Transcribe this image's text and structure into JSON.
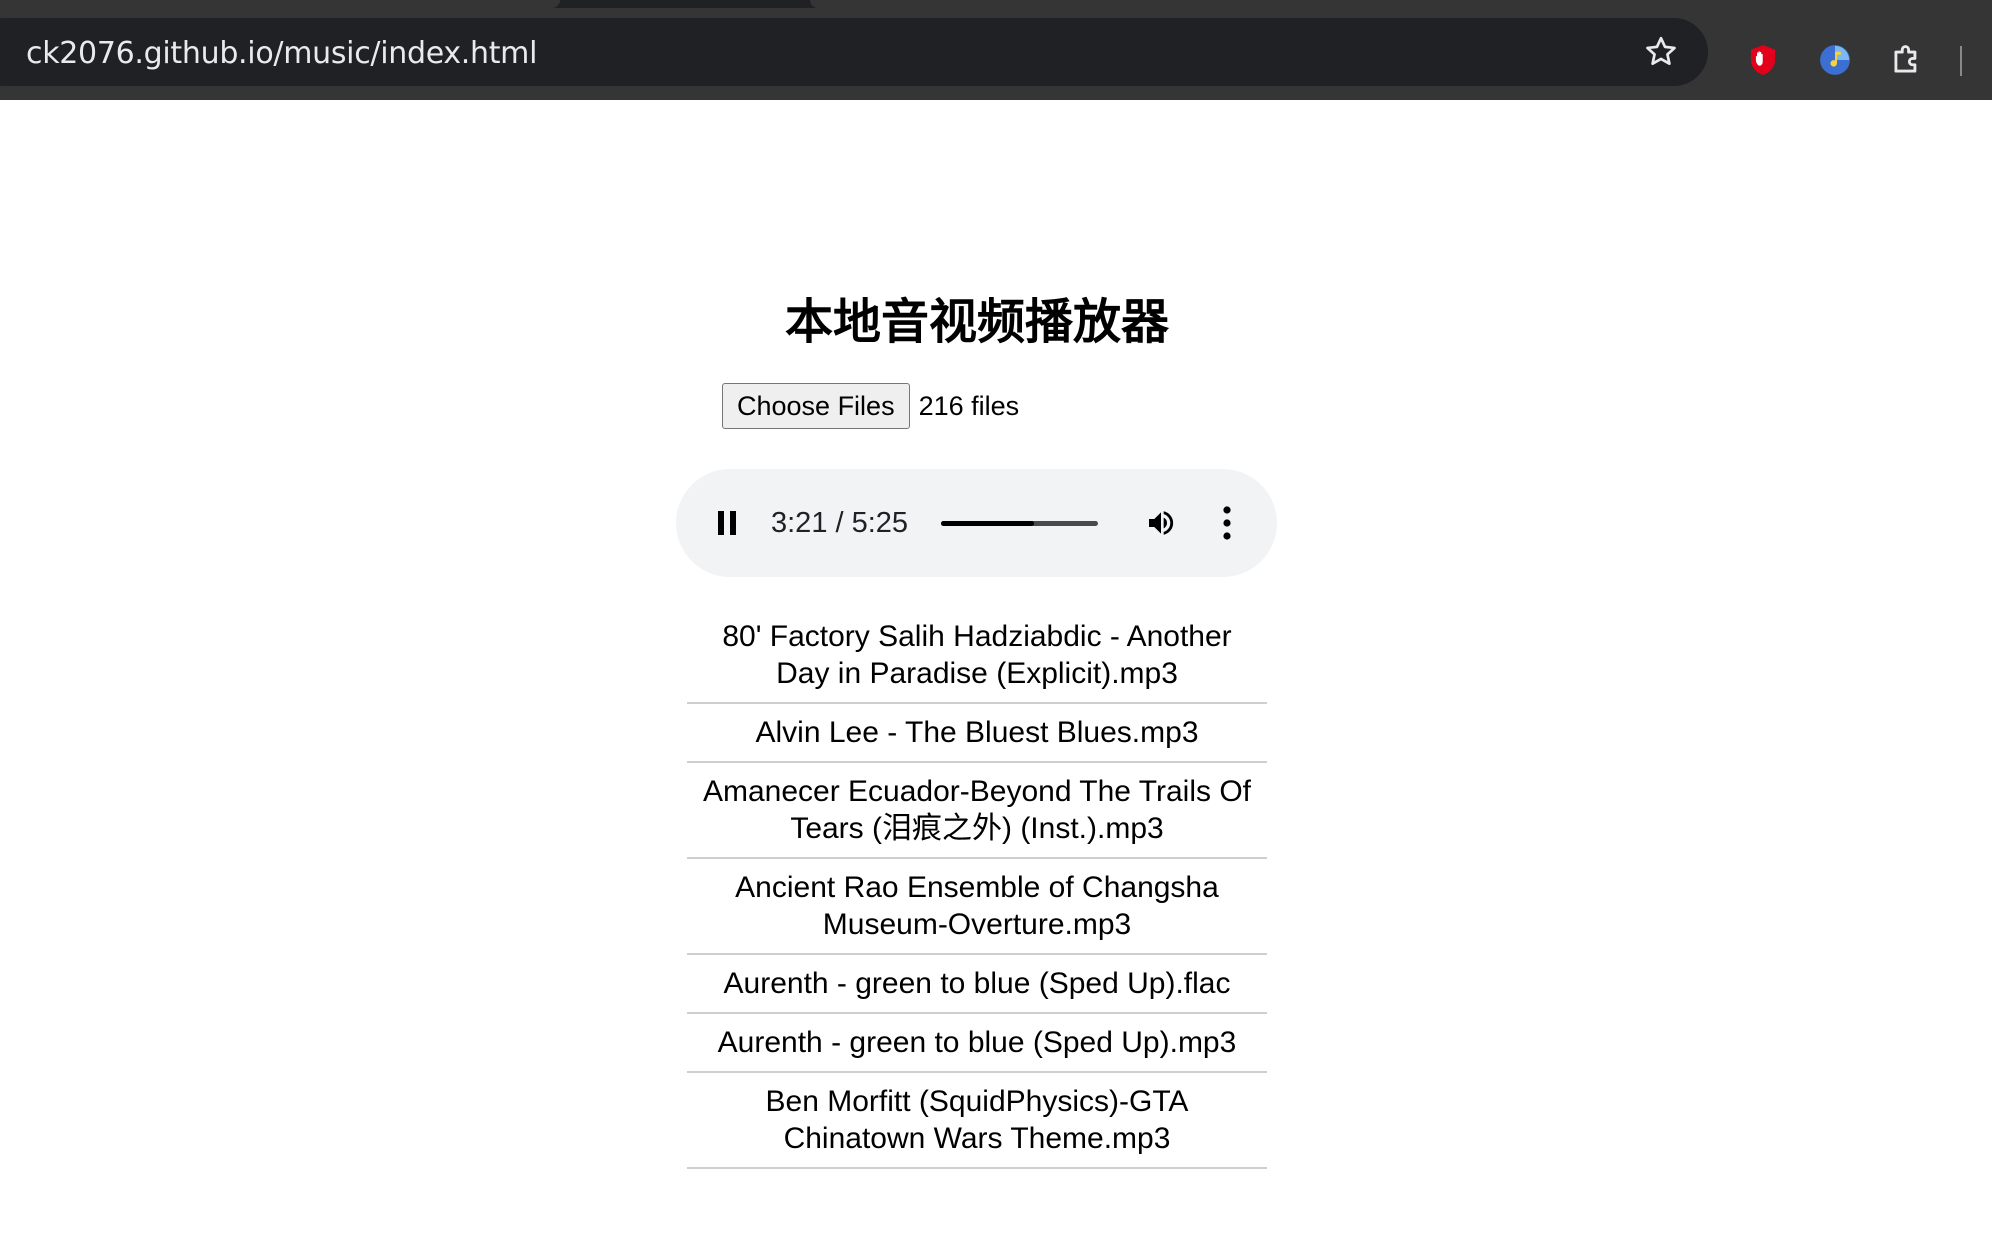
{
  "browser": {
    "url": "ck2076.github.io/music/index.html",
    "icons": [
      "star-icon",
      "ublock-hand-icon",
      "music-extension-icon",
      "extensions-puzzle-icon"
    ],
    "colors": {
      "frame": "#353535",
      "omnibox": "#202124",
      "ublock": "#e3001b"
    }
  },
  "page": {
    "title": "本地音视频播放器",
    "file_input": {
      "button_label": "Choose Files",
      "status": "216 files"
    },
    "player": {
      "state": "playing",
      "time": "3:21 / 5:25",
      "progress": 0.59
    },
    "tracks": [
      "80' Factory Salih Hadziabdic - Another Day in Paradise (Explicit).mp3",
      "Alvin Lee - The Bluest Blues.mp3",
      "Amanecer Ecuador-Beyond The Trails Of Tears (泪痕之外) (Inst.).mp3",
      "Ancient Rao Ensemble of Changsha Museum-Overture.mp3",
      "Aurenth - green to blue (Sped Up).flac",
      "Aurenth - green to blue (Sped Up).mp3",
      "Ben Morfitt (SquidPhysics)-GTA Chinatown Wars Theme.mp3"
    ]
  }
}
